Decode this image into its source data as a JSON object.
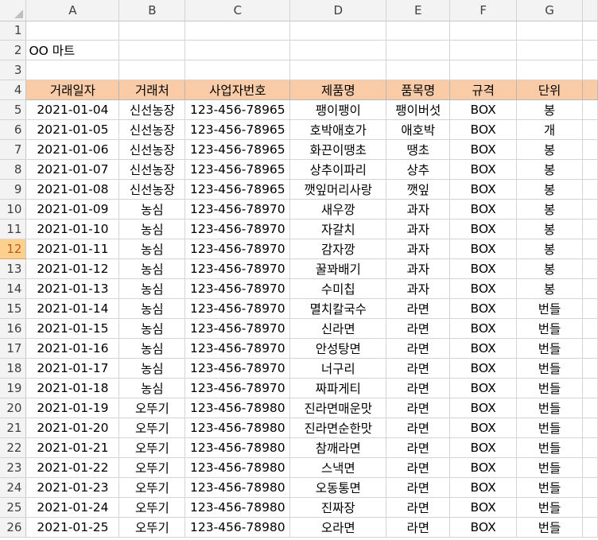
{
  "sheet": {
    "columns": [
      "A",
      "B",
      "C",
      "D",
      "E",
      "F",
      "G"
    ],
    "selected_row": "12",
    "title_row_number": "2",
    "title_text": "OO 마트",
    "header_row_number": "4",
    "headers": [
      "거래일자",
      "거래처",
      "사업자번호",
      "제품명",
      "품목명",
      "규격",
      "단위"
    ],
    "empty_rows": [
      "1",
      "3"
    ],
    "rows": [
      {
        "n": "5",
        "cells": [
          "2021-01-04",
          "신선농장",
          "123-456-78965",
          "팽이팽이",
          "팽이버섯",
          "BOX",
          "봉"
        ]
      },
      {
        "n": "6",
        "cells": [
          "2021-01-05",
          "신선농장",
          "123-456-78965",
          "호박애호가",
          "애호박",
          "BOX",
          "개"
        ]
      },
      {
        "n": "7",
        "cells": [
          "2021-01-06",
          "신선농장",
          "123-456-78965",
          "화끈이땡초",
          "땡초",
          "BOX",
          "봉"
        ]
      },
      {
        "n": "8",
        "cells": [
          "2021-01-07",
          "신선농장",
          "123-456-78965",
          "상추이파리",
          "상추",
          "BOX",
          "봉"
        ]
      },
      {
        "n": "9",
        "cells": [
          "2021-01-08",
          "신선농장",
          "123-456-78965",
          "깻잎머리사랑",
          "깻잎",
          "BOX",
          "봉"
        ]
      },
      {
        "n": "10",
        "cells": [
          "2021-01-09",
          "농심",
          "123-456-78970",
          "새우깡",
          "과자",
          "BOX",
          "봉"
        ]
      },
      {
        "n": "11",
        "cells": [
          "2021-01-10",
          "농심",
          "123-456-78970",
          "자갈치",
          "과자",
          "BOX",
          "봉"
        ]
      },
      {
        "n": "12",
        "cells": [
          "2021-01-11",
          "농심",
          "123-456-78970",
          "감자깡",
          "과자",
          "BOX",
          "봉"
        ]
      },
      {
        "n": "13",
        "cells": [
          "2021-01-12",
          "농심",
          "123-456-78970",
          "꿀꽈배기",
          "과자",
          "BOX",
          "봉"
        ]
      },
      {
        "n": "14",
        "cells": [
          "2021-01-13",
          "농심",
          "123-456-78970",
          "수미칩",
          "과자",
          "BOX",
          "봉"
        ]
      },
      {
        "n": "15",
        "cells": [
          "2021-01-14",
          "농심",
          "123-456-78970",
          "멸치칼국수",
          "라면",
          "BOX",
          "번들"
        ]
      },
      {
        "n": "16",
        "cells": [
          "2021-01-15",
          "농심",
          "123-456-78970",
          "신라면",
          "라면",
          "BOX",
          "번들"
        ]
      },
      {
        "n": "17",
        "cells": [
          "2021-01-16",
          "농심",
          "123-456-78970",
          "안성탕면",
          "라면",
          "BOX",
          "번들"
        ]
      },
      {
        "n": "18",
        "cells": [
          "2021-01-17",
          "농심",
          "123-456-78970",
          "너구리",
          "라면",
          "BOX",
          "번들"
        ]
      },
      {
        "n": "19",
        "cells": [
          "2021-01-18",
          "농심",
          "123-456-78970",
          "짜파게티",
          "라면",
          "BOX",
          "번들"
        ]
      },
      {
        "n": "20",
        "cells": [
          "2021-01-19",
          "오뚜기",
          "123-456-78980",
          "진라면매운맛",
          "라면",
          "BOX",
          "번들"
        ]
      },
      {
        "n": "21",
        "cells": [
          "2021-01-20",
          "오뚜기",
          "123-456-78980",
          "진라면순한맛",
          "라면",
          "BOX",
          "번들"
        ]
      },
      {
        "n": "22",
        "cells": [
          "2021-01-21",
          "오뚜기",
          "123-456-78980",
          "참깨라면",
          "라면",
          "BOX",
          "번들"
        ]
      },
      {
        "n": "23",
        "cells": [
          "2021-01-22",
          "오뚜기",
          "123-456-78980",
          "스낵면",
          "라면",
          "BOX",
          "번들"
        ]
      },
      {
        "n": "24",
        "cells": [
          "2021-01-23",
          "오뚜기",
          "123-456-78980",
          "오동통면",
          "라면",
          "BOX",
          "번들"
        ]
      },
      {
        "n": "25",
        "cells": [
          "2021-01-24",
          "오뚜기",
          "123-456-78980",
          "진짜장",
          "라면",
          "BOX",
          "번들"
        ]
      },
      {
        "n": "26",
        "cells": [
          "2021-01-25",
          "오뚜기",
          "123-456-78980",
          "오라면",
          "라면",
          "BOX",
          "번들"
        ]
      }
    ],
    "colors": {
      "header_fill": "#f9cba7",
      "selected_row_header": "#fcd18f",
      "gridline": "#d4d4d4"
    }
  }
}
